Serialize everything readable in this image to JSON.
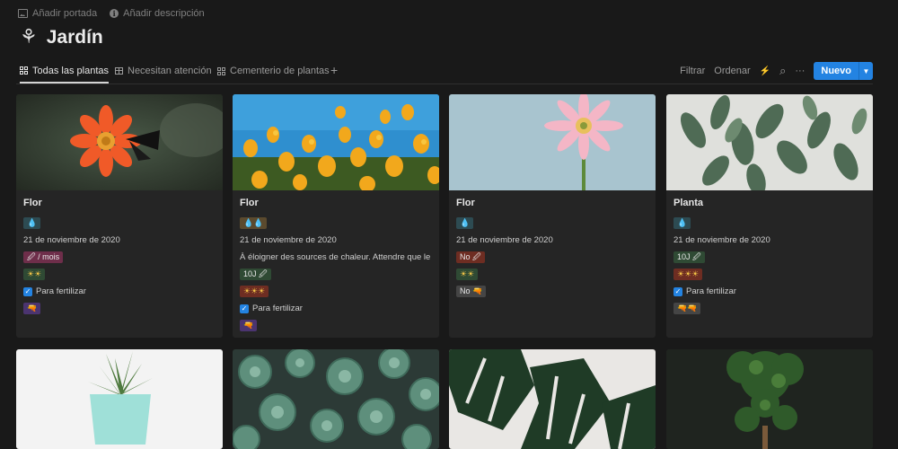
{
  "page": {
    "add_cover": "Añadir portada",
    "add_description": "Añadir descripción",
    "title_icon": "⚘",
    "title": "Jardín"
  },
  "tabs": [
    {
      "label": "Todas las plantas",
      "icon": "gallery-icon",
      "active": true
    },
    {
      "label": "Necesitan atención",
      "icon": "table-icon",
      "active": false
    },
    {
      "label": "Cementerio de plantas",
      "icon": "gallery-icon",
      "active": false
    }
  ],
  "toolbar": {
    "filter": "Filtrar",
    "sort": "Ordenar",
    "lightning": "⚡",
    "search": "⌕",
    "more": "···",
    "new": "Nuevo",
    "caret": "▼"
  },
  "colors": {
    "accent": "#2383e2",
    "background": "#191919",
    "card": "#252525"
  },
  "cards": [
    {
      "title": "Flor",
      "water": "💧",
      "date": "21 de noviembre de 2020",
      "fertilize_freq": "🖉 / mois",
      "sun": "☀☀",
      "fertilize_label": "Para fertilizar",
      "fertilize_checked": true,
      "gun": "🔫"
    },
    {
      "title": "Flor",
      "water": "💧💧",
      "date": "21 de noviembre de 2020",
      "note": "À éloigner des sources de chaleur. Attendre que le terreau",
      "fertilize_freq": "10J 🖉",
      "sun": "☀☀☀",
      "fertilize_label": "Para fertilizar",
      "fertilize_checked": true,
      "gun": "🔫"
    },
    {
      "title": "Flor",
      "water": "💧",
      "date": "21 de noviembre de 2020",
      "fertilize_freq": "No 🖉",
      "sun": "☀☀",
      "no_gun": "No 🔫"
    },
    {
      "title": "Planta",
      "water": "💧",
      "date": "21 de noviembre de 2020",
      "fertilize_freq": "10J 🖉",
      "sun": "☀☀☀",
      "fertilize_label": "Para fertilizar",
      "fertilize_checked": true,
      "gun": "🔫🔫"
    }
  ],
  "check_mark": "✓"
}
